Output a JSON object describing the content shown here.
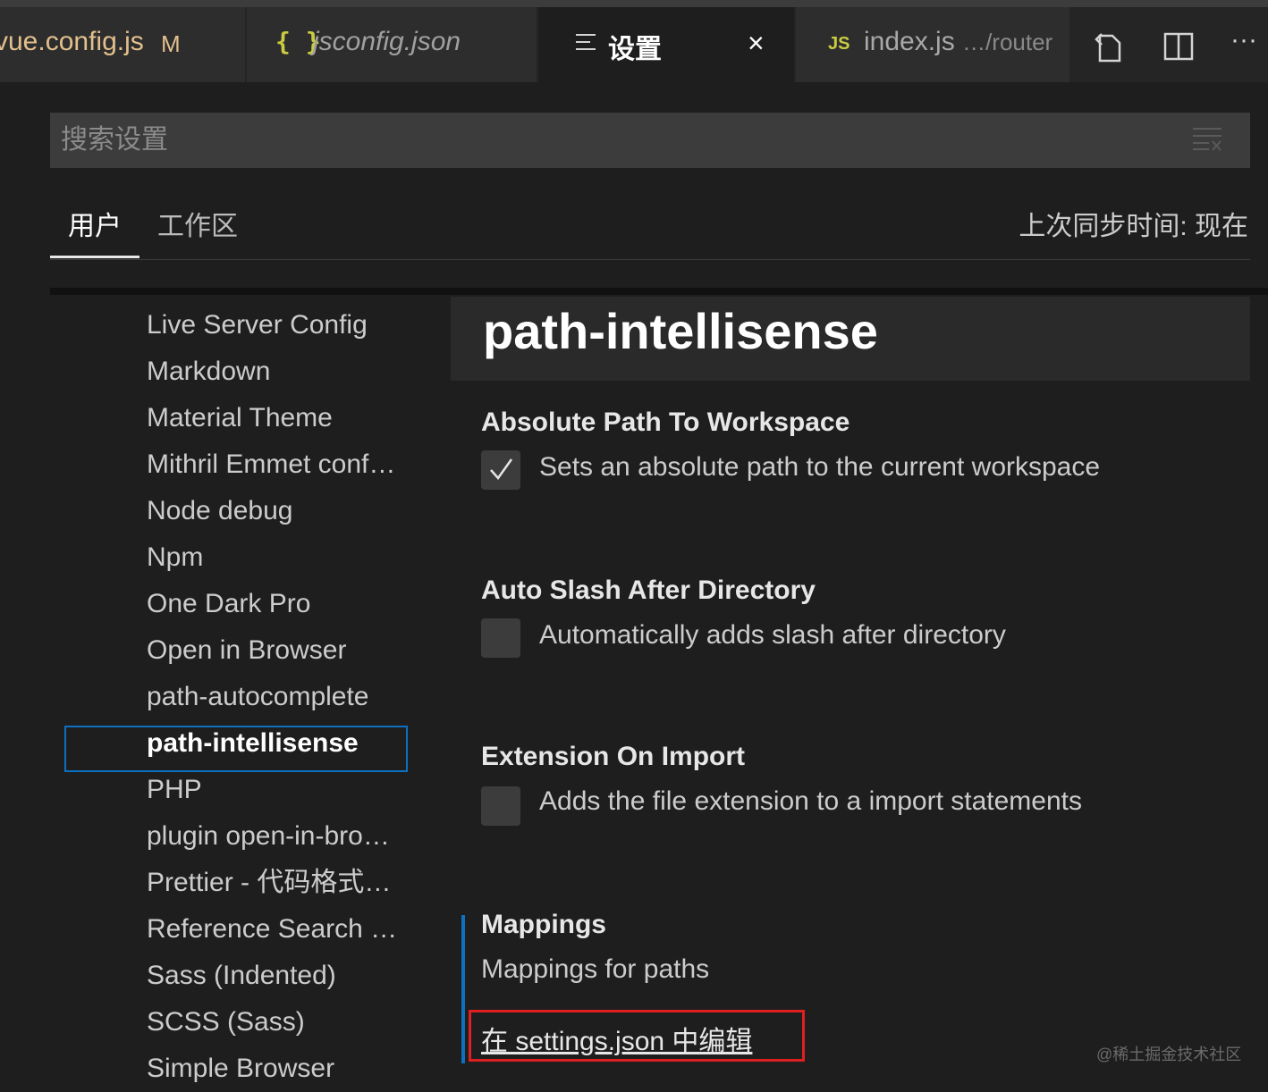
{
  "tabs": {
    "tab1": {
      "label": "vue.config.js",
      "badge": "M"
    },
    "tab2": {
      "icon": "{ }",
      "label": "jsconfig.json"
    },
    "tab3": {
      "label": "设置",
      "close": "×"
    },
    "tab4": {
      "icon": "JS",
      "label": "index.js",
      "path": "…/router"
    }
  },
  "actions": {
    "more": "···"
  },
  "search": {
    "placeholder": "搜索设置"
  },
  "scopes": {
    "user": "用户",
    "workspace": "工作区"
  },
  "sync_status": "上次同步时间: 现在",
  "toc": [
    "Live Server Config",
    "Markdown",
    "Material Theme",
    "Mithril Emmet conf…",
    "Node debug",
    "Npm",
    "One Dark Pro",
    "Open in Browser",
    "path-autocomplete",
    "path-intellisense",
    "PHP",
    "plugin open-in-bro…",
    "Prettier - 代码格式…",
    "Reference Search …",
    "Sass (Indented)",
    "SCSS (Sass)",
    "Simple Browser"
  ],
  "toc_active": "path-intellisense",
  "group_title": "path-intellisense",
  "settings": [
    {
      "title": "Absolute Path To Workspace",
      "description": "Sets an absolute path to the current workspace",
      "checked": true
    },
    {
      "title": "Auto Slash After Directory",
      "description": "Automatically adds slash after directory",
      "checked": false
    },
    {
      "title": "Extension On Import",
      "description": "Adds the file extension to a import statements",
      "checked": false
    }
  ],
  "mappings": {
    "title": "Mappings",
    "description": "Mappings for paths",
    "edit_link": "在 settings.json 中编辑"
  },
  "watermark": "@稀土掘金技术社区",
  "colors": {
    "accent": "#0e70c0",
    "highlight": "#e02020",
    "background": "#1e1e1e"
  }
}
